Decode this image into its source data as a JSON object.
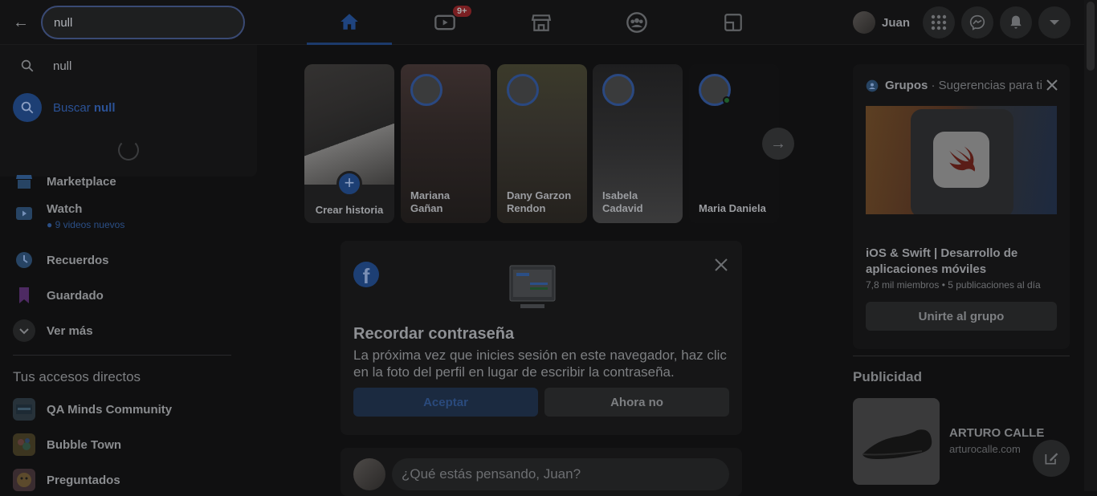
{
  "search": {
    "value": "null"
  },
  "nav": {
    "tabs": [
      {
        "name": "home"
      },
      {
        "name": "watch",
        "badge": "9+"
      },
      {
        "name": "marketplace"
      },
      {
        "name": "groups"
      },
      {
        "name": "gaming"
      }
    ]
  },
  "profile": {
    "name": "Juan"
  },
  "dropdown": {
    "recent": "null",
    "search_label": "Buscar",
    "search_term": "null"
  },
  "sidebar": {
    "items": [
      {
        "label": "Marketplace"
      },
      {
        "label": "Watch",
        "sub": "9 videos nuevos"
      },
      {
        "label": "Recuerdos"
      },
      {
        "label": "Guardado"
      },
      {
        "label": "Ver más"
      }
    ],
    "shortcuts_title": "Tus accesos directos",
    "shortcuts": [
      {
        "label": "QA Minds Community"
      },
      {
        "label": "Bubble Town"
      },
      {
        "label": "Preguntados"
      }
    ]
  },
  "stories": {
    "create_label": "Crear historia",
    "items": [
      {
        "name": "Mariana Gañan"
      },
      {
        "name": "Dany Garzon Rendon"
      },
      {
        "name": "Isabela Cadavid"
      },
      {
        "name": "Maria Daniela"
      }
    ]
  },
  "password_card": {
    "title": "Recordar contraseña",
    "body": "La próxima vez que inicies sesión en este navegador, haz clic en la foto del perfil en lugar de escribir la contraseña.",
    "accept": "Aceptar",
    "decline": "Ahora no"
  },
  "composer": {
    "placeholder": "¿Qué estás pensando, Juan?"
  },
  "groups": {
    "title": "Grupos",
    "subtitle": " · Sugerencias para ti",
    "group_name": "iOS & Swift | Desarrollo de aplicaciones móviles",
    "group_meta": "7,8 mil miembros • 5 publicaciones al día",
    "join": "Unirte al grupo"
  },
  "ads": {
    "heading": "Publicidad",
    "advertiser": "ARTURO CALLE",
    "domain": "arturocalle.com"
  },
  "colors": {
    "overlay": "#101011",
    "accent": "#1d3f74"
  }
}
